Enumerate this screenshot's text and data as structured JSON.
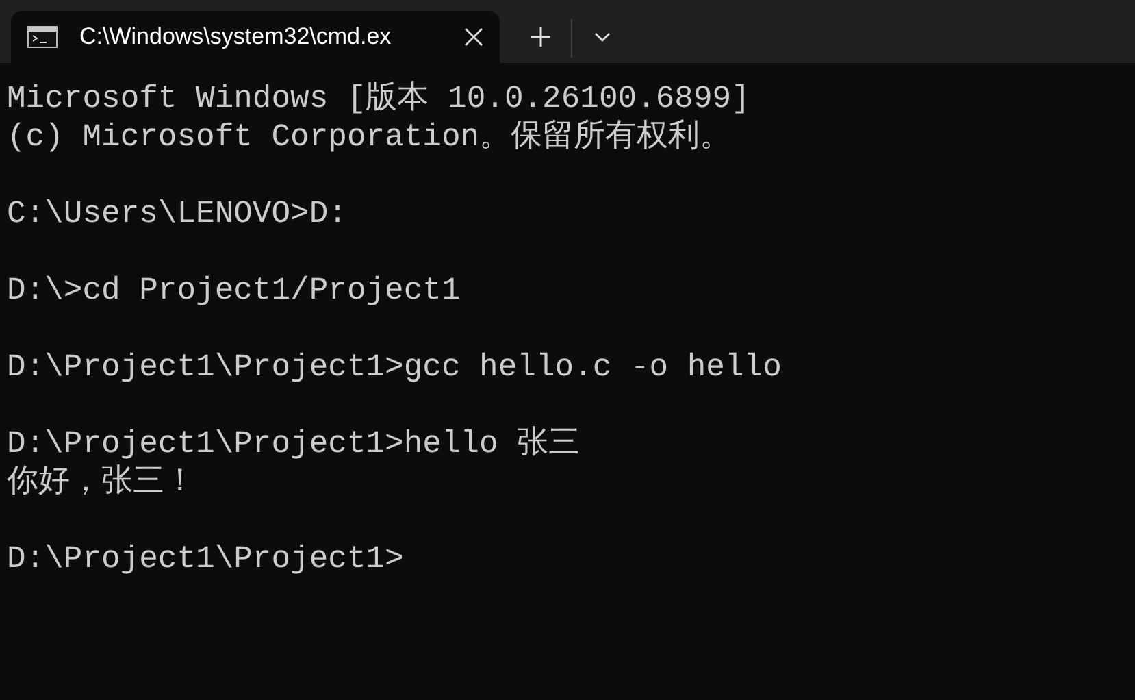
{
  "tabs": [
    {
      "title": "C:\\Windows\\system32\\cmd.ex",
      "selected": true
    }
  ],
  "terminal": {
    "blocks": [
      {
        "lines": [
          "Microsoft Windows [版本 10.0.26100.6899]",
          "(c) Microsoft Corporation。保留所有权利。"
        ]
      },
      {
        "lines": [
          "C:\\Users\\LENOVO>D:"
        ]
      },
      {
        "lines": [
          "D:\\>cd Project1/Project1"
        ]
      },
      {
        "lines": [
          "D:\\Project1\\Project1>gcc hello.c -o hello"
        ]
      },
      {
        "lines": [
          "D:\\Project1\\Project1>hello 张三",
          "你好，张三！"
        ]
      },
      {
        "lines": [
          "D:\\Project1\\Project1>"
        ]
      }
    ]
  }
}
